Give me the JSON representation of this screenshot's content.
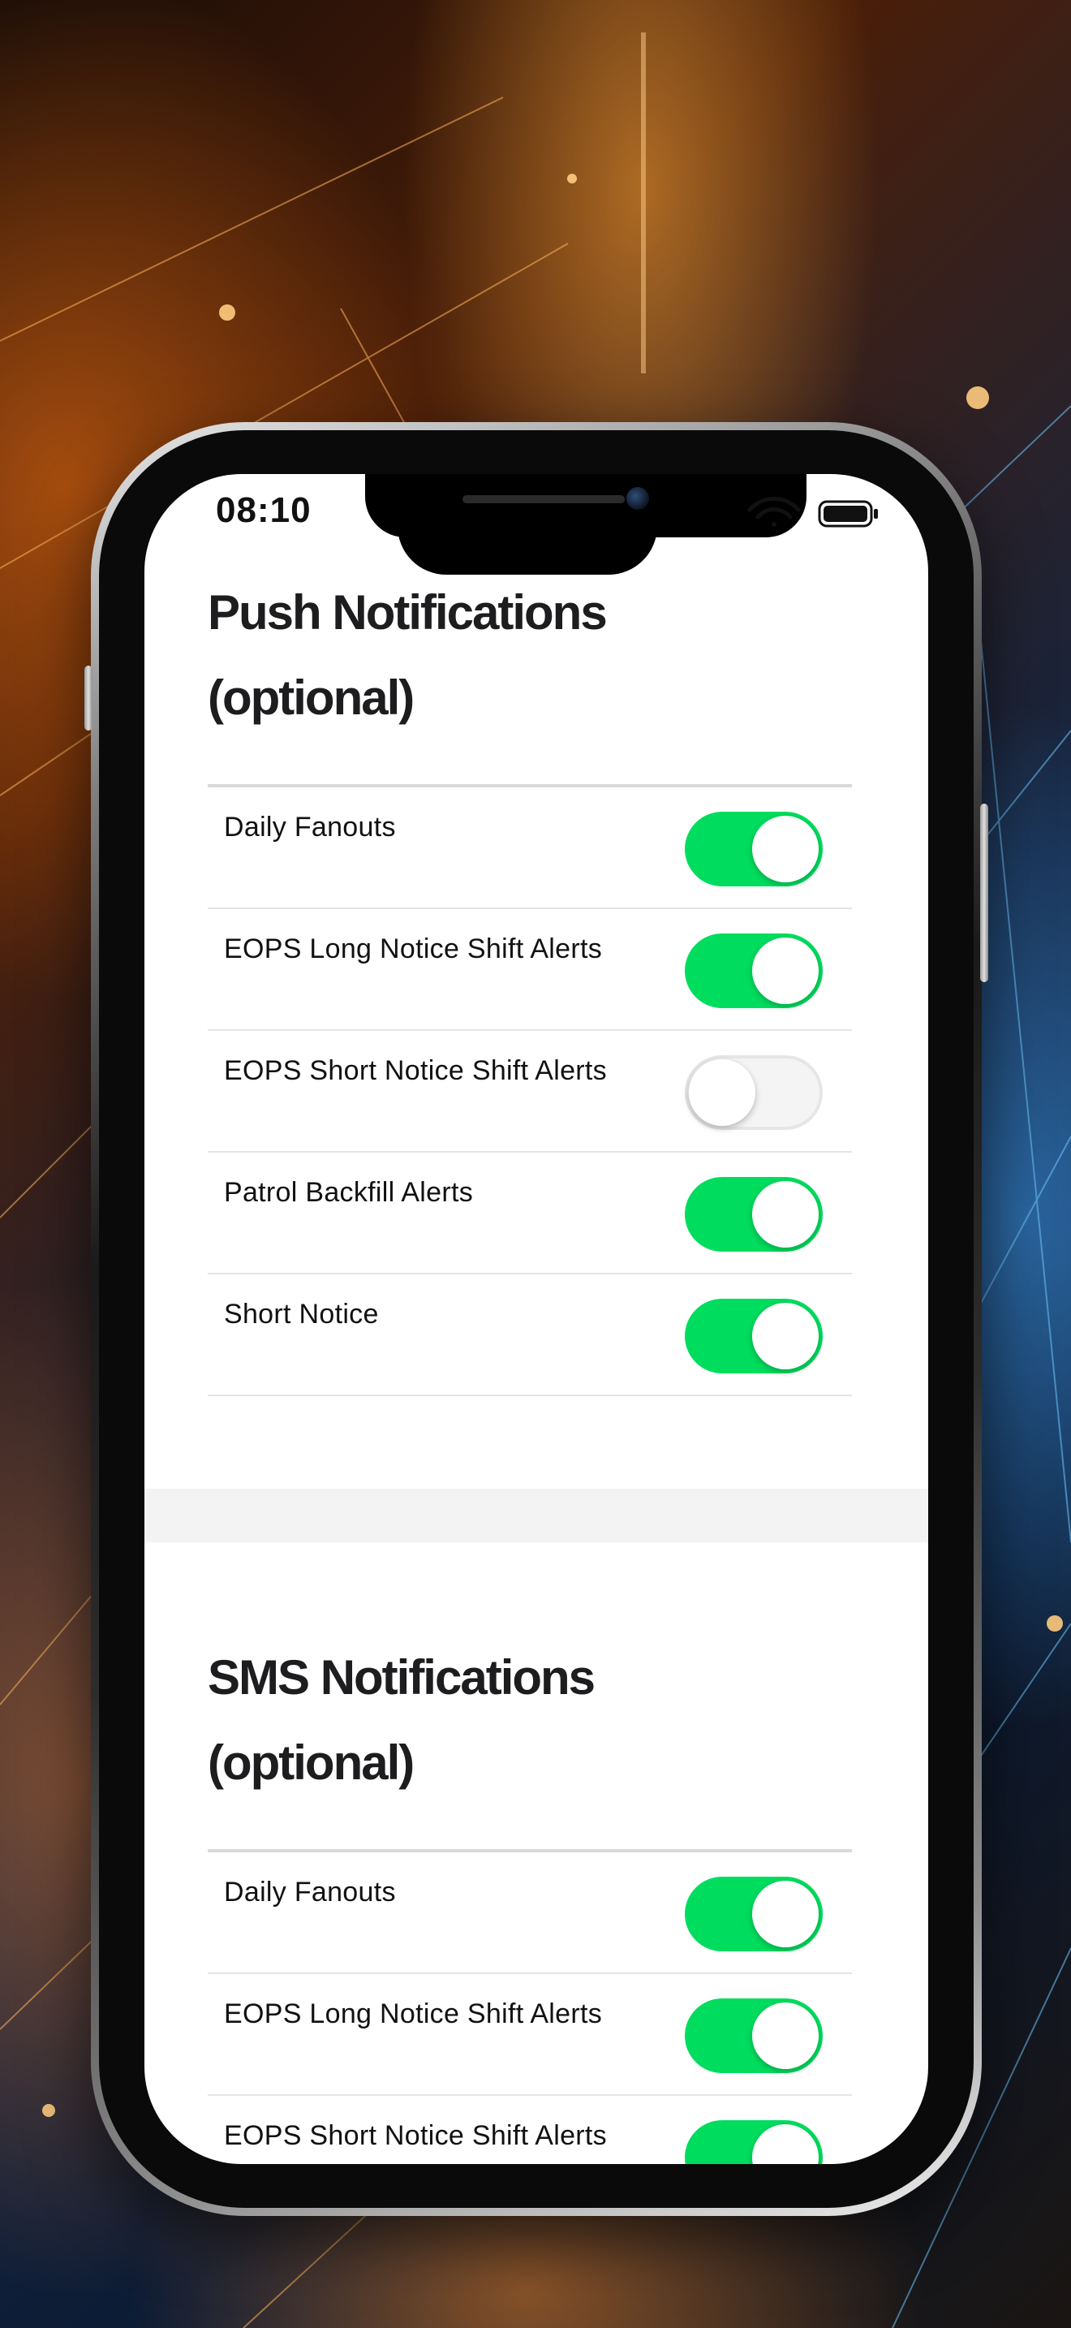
{
  "status_bar": {
    "time": "08:10",
    "icons": [
      "wifi-icon",
      "battery-icon"
    ]
  },
  "push_section": {
    "title_line1": "Push Notifications",
    "title_line2": "(optional)",
    "items": [
      {
        "label": "Daily Fanouts",
        "enabled": true
      },
      {
        "label": "EOPS Long Notice Shift Alerts",
        "enabled": true
      },
      {
        "label": "EOPS Short Notice Shift Alerts",
        "enabled": false
      },
      {
        "label": "Patrol Backfill Alerts",
        "enabled": true
      },
      {
        "label": "Short Notice",
        "enabled": true
      }
    ]
  },
  "sms_section": {
    "title_line1": "SMS Notifications",
    "title_line2": "(optional)",
    "items": [
      {
        "label": "Daily Fanouts",
        "enabled": true
      },
      {
        "label": "EOPS Long Notice Shift Alerts",
        "enabled": true
      },
      {
        "label": "EOPS Short Notice Shift Alerts",
        "enabled": true
      }
    ]
  },
  "colors": {
    "toggle_on": "#00dd5e",
    "toggle_off": "#f4f4f4",
    "title_text": "#1d1d1f"
  }
}
